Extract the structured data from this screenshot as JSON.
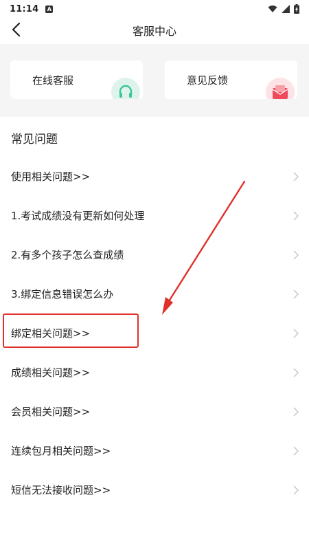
{
  "status_bar": {
    "time": "11:14",
    "notif_letter": "A"
  },
  "header": {
    "title": "客服中心"
  },
  "cards": [
    {
      "label": "在线客服",
      "icon": "headset-icon",
      "icon_color": "#3cc79a"
    },
    {
      "label": "意见反馈",
      "icon": "envelope-icon",
      "icon_color": "#ee4a5b"
    }
  ],
  "faq": {
    "title": "常见问题",
    "items": [
      {
        "label": "使用相关问题>>"
      },
      {
        "label": "1.考试成绩没有更新如何处理"
      },
      {
        "label": "2.有多个孩子怎么查成绩"
      },
      {
        "label": "3.绑定信息错误怎么办"
      },
      {
        "label": "绑定相关问题>>"
      },
      {
        "label": "成绩相关问题>>"
      },
      {
        "label": "会员相关问题>>"
      },
      {
        "label": "连续包月相关问题>>"
      },
      {
        "label": "短信无法接收问题>>"
      }
    ]
  },
  "annotation": {
    "color": "#e0302a"
  }
}
